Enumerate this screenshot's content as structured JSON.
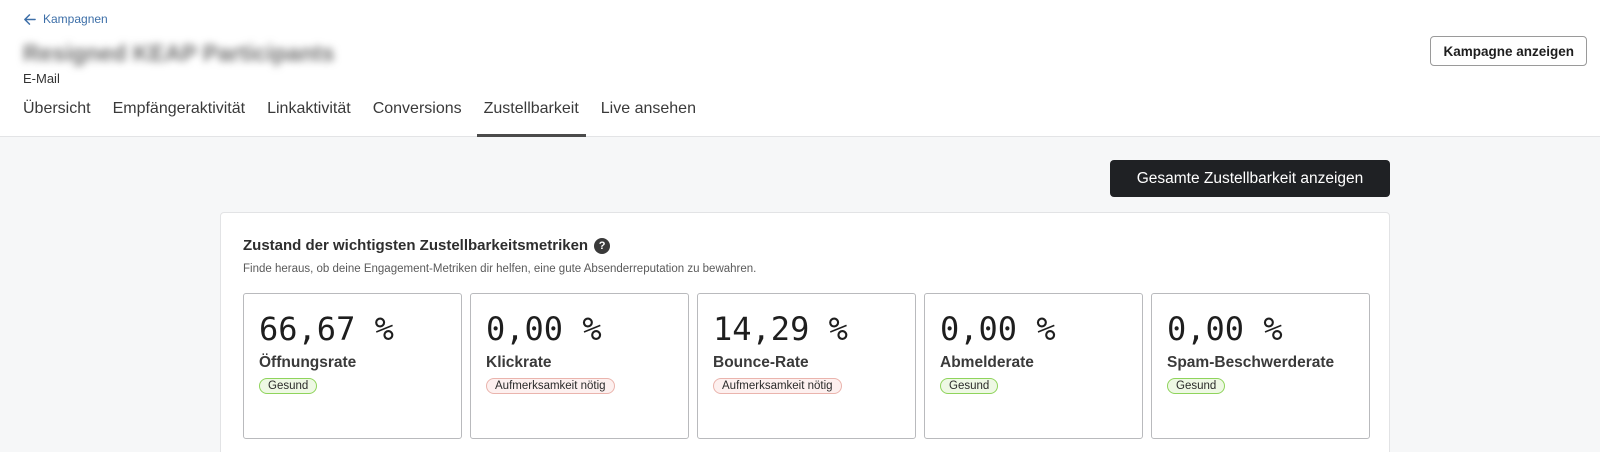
{
  "header": {
    "back_label": "Kampagnen",
    "campaign_title": "Resigned KEAP Participants",
    "campaign_type": "E-Mail",
    "view_campaign_label": "Kampagne anzeigen"
  },
  "tabs": [
    {
      "label": "Übersicht",
      "active": false
    },
    {
      "label": "Empfängeraktivität",
      "active": false
    },
    {
      "label": "Linkaktivität",
      "active": false
    },
    {
      "label": "Conversions",
      "active": false
    },
    {
      "label": "Zustellbarkeit",
      "active": true
    },
    {
      "label": "Live ansehen",
      "active": false
    }
  ],
  "toolbar": {
    "overall_deliverability_label": "Gesamte Zustellbarkeit anzeigen"
  },
  "card": {
    "title": "Zustand der wichtigsten Zustellbarkeitsmetriken",
    "help_glyph": "?",
    "subtitle": "Finde heraus, ob deine Engagement-Metriken dir helfen, eine gute Absenderreputation zu bewahren.",
    "metrics": [
      {
        "value": "66,67 %",
        "label": "Öffnungsrate",
        "status": "Gesund",
        "status_type": "ok"
      },
      {
        "value": "0,00 %",
        "label": "Klickrate",
        "status": "Aufmerksamkeit nötig",
        "status_type": "warn"
      },
      {
        "value": "14,29 %",
        "label": "Bounce-Rate",
        "status": "Aufmerksamkeit nötig",
        "status_type": "warn"
      },
      {
        "value": "0,00 %",
        "label": "Abmelderate",
        "status": "Gesund",
        "status_type": "ok"
      },
      {
        "value": "0,00 %",
        "label": "Spam-Beschwerderate",
        "status": "Gesund",
        "status_type": "ok"
      }
    ]
  },
  "colors": {
    "link": "#3d6fa8",
    "primary_button": "#1f2124",
    "ok_border": "#8fd45c",
    "warn_border": "#eab4ad"
  },
  "icons": {
    "back": "arrow-left-icon",
    "help": "question-circle-icon"
  }
}
